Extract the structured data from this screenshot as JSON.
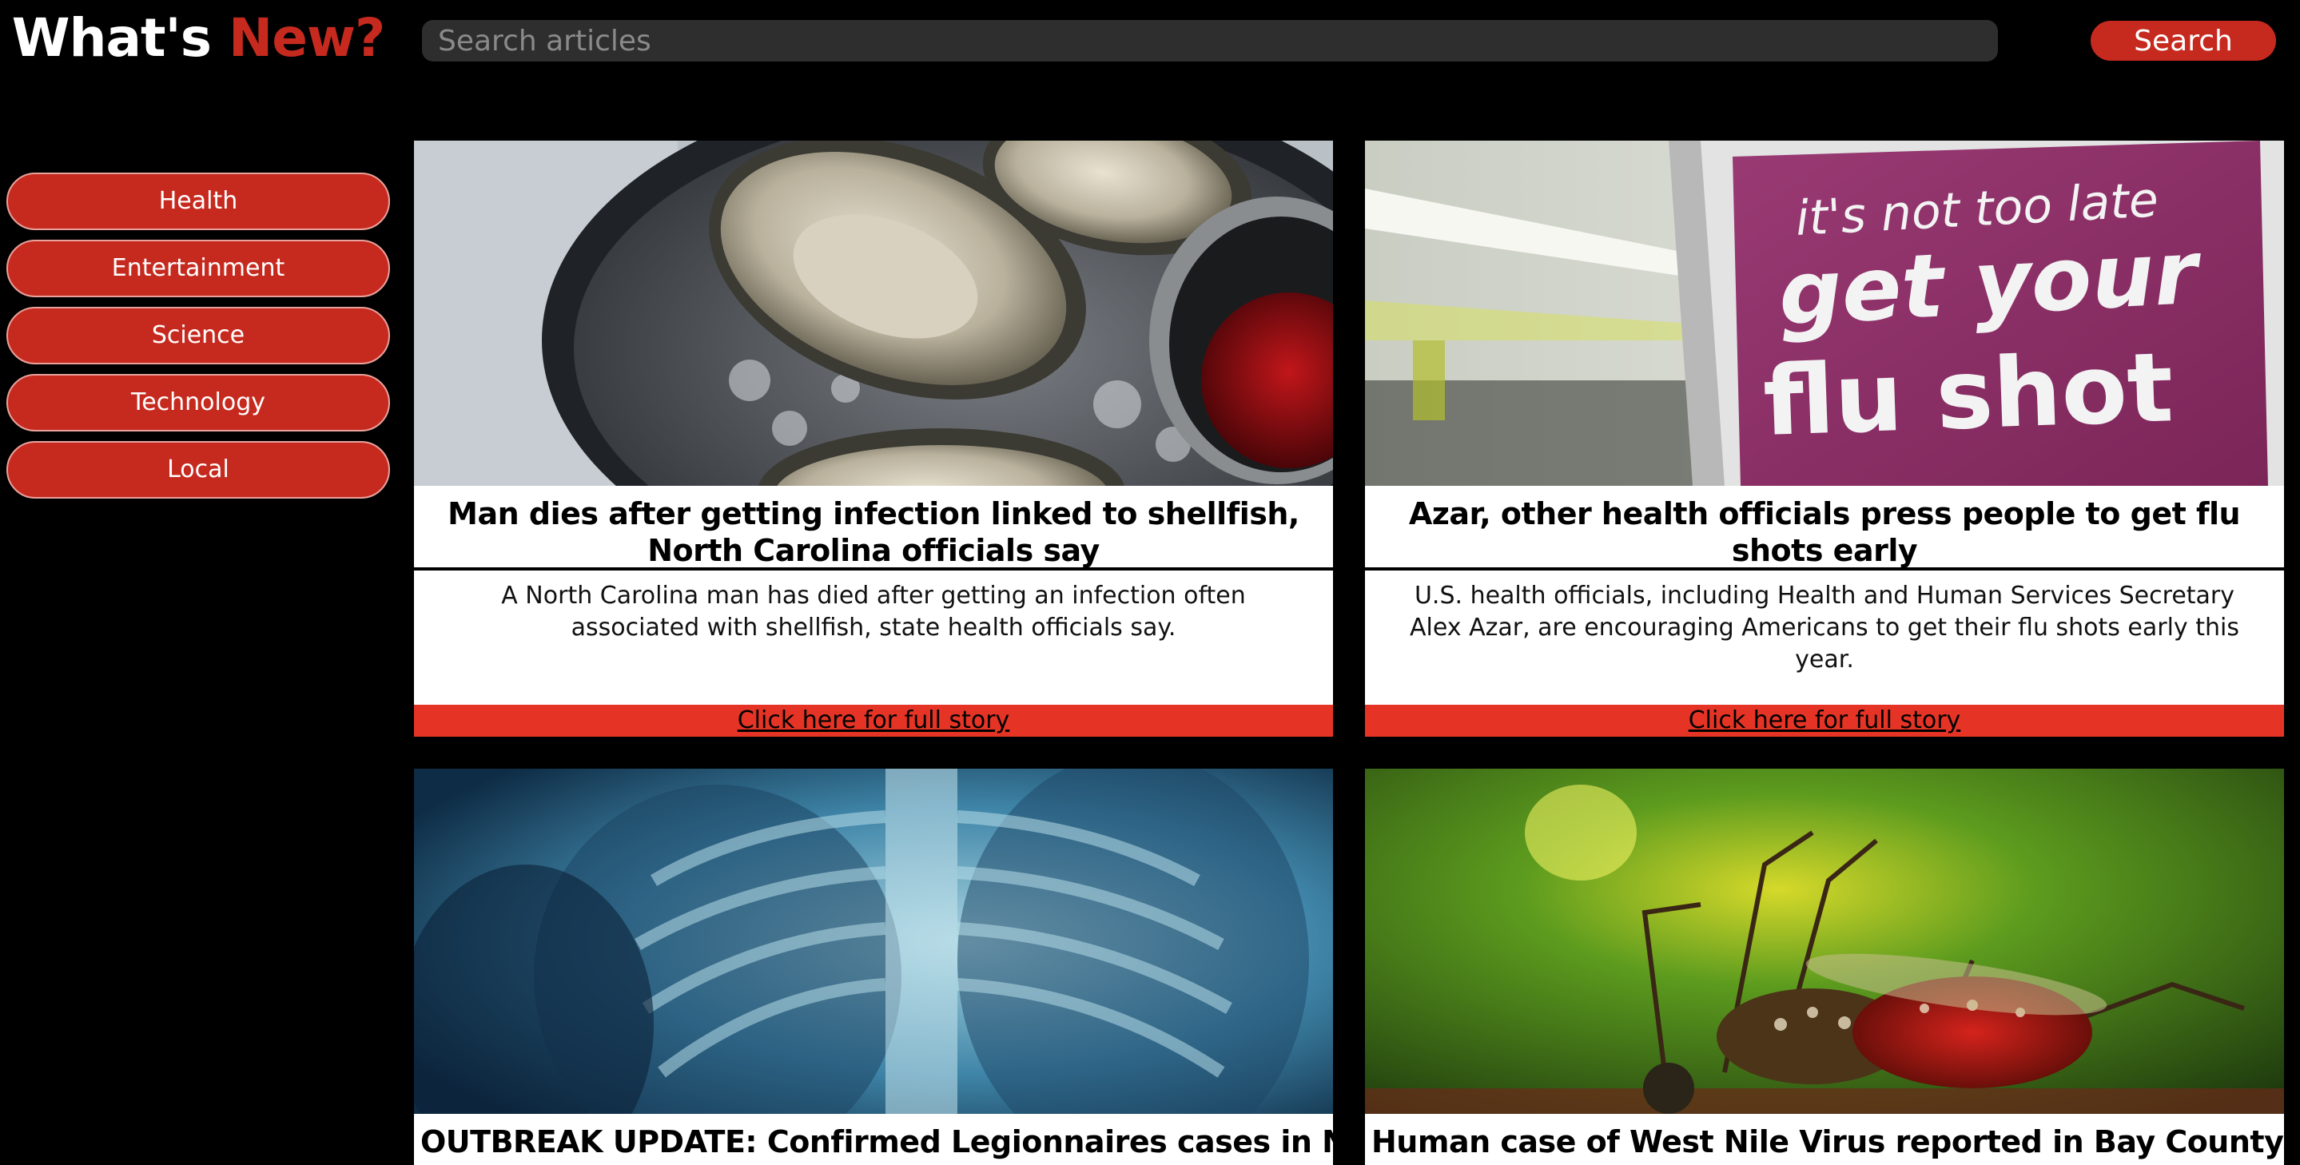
{
  "header": {
    "logo_main": "What's",
    "logo_accent": "New?",
    "search_placeholder": "Search articles",
    "search_button_label": "Search"
  },
  "sidebar": {
    "items": [
      {
        "label": "Health"
      },
      {
        "label": "Entertainment"
      },
      {
        "label": "Science"
      },
      {
        "label": "Technology"
      },
      {
        "label": "Local"
      }
    ]
  },
  "articles": [
    {
      "image": "oysters-on-ice-photo",
      "headline": "Man dies after getting infection linked to shellfish, North Carolina officials say",
      "summary": "A North Carolina man has died after getting an infection often associated with shellfish, state health officials say.",
      "link_label": "Click here for full story"
    },
    {
      "image": "flu-shot-sign-photo",
      "image_text": [
        "it's not too late",
        "get your",
        "flu shot"
      ],
      "headline": "Azar, other health officials press people to get flu shots early",
      "summary": "U.S. health officials, including Health and Human Services Secretary Alex Azar, are encouraging Americans to get their flu shots early this year.",
      "link_label": "Click here for full story"
    },
    {
      "image": "chest-xray-photo",
      "headline": "OUTBREAK UPDATE: Confirmed Legionnaires cases in NC, SC increase to"
    },
    {
      "image": "mosquito-photo",
      "headline": "Human case of West Nile Virus reported in Bay County"
    }
  ],
  "colors": {
    "background": "#000000",
    "accent": "#c62a1f",
    "link_bar": "#e53425",
    "search_field": "#2e2e2e",
    "flu_sign": "#8c2f68"
  }
}
